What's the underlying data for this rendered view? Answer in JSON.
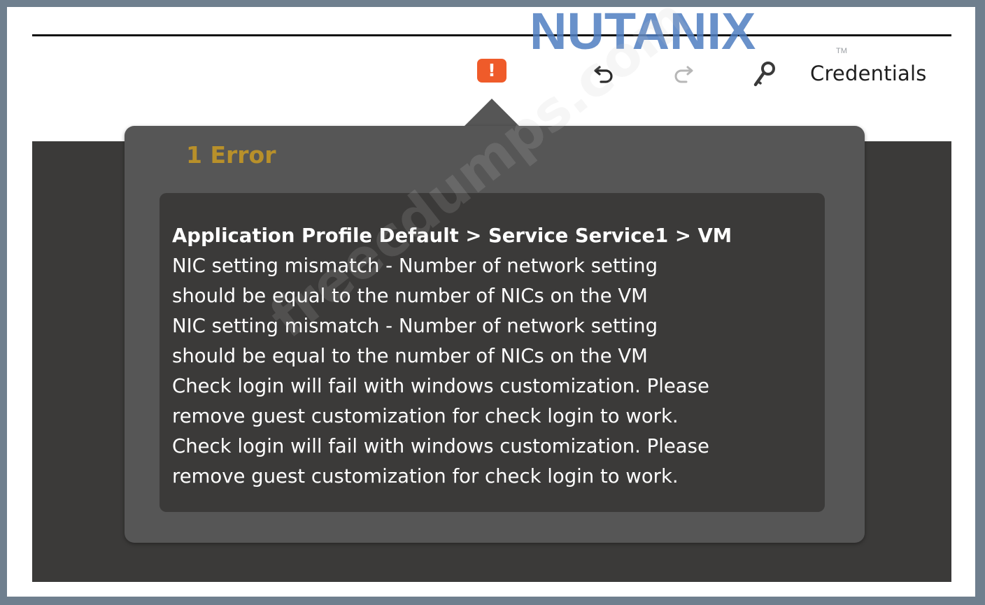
{
  "brand": {
    "logo_text": "NUTANIX",
    "trademark": "TM",
    "colors": {
      "blue": "#4f7ec1",
      "green": "#a6c843",
      "gray": "#9a9ea3"
    }
  },
  "toolbar": {
    "error_badge": "!",
    "error_badge_color": "#ef5b2a",
    "undo_icon": "undo-icon",
    "redo_icon": "redo-icon",
    "key_icon": "key-icon",
    "credentials_label": "Credentials"
  },
  "error_popover": {
    "title": "1 Error",
    "title_color": "#b8902a",
    "path": "Application Profile Default > Service Service1 > VM",
    "lines": [
      "NIC setting mismatch - Number of network setting",
      "should be equal to the number of NICs on the VM",
      "NIC setting mismatch - Number of network setting",
      "should be equal to the number of NICs on the VM",
      "Check login will fail with windows customization. Please",
      "remove guest customization for check login to work.",
      "Check login will fail with windows customization. Please",
      "remove guest customization for check login to work."
    ]
  },
  "watermark": "freecdumps.com"
}
